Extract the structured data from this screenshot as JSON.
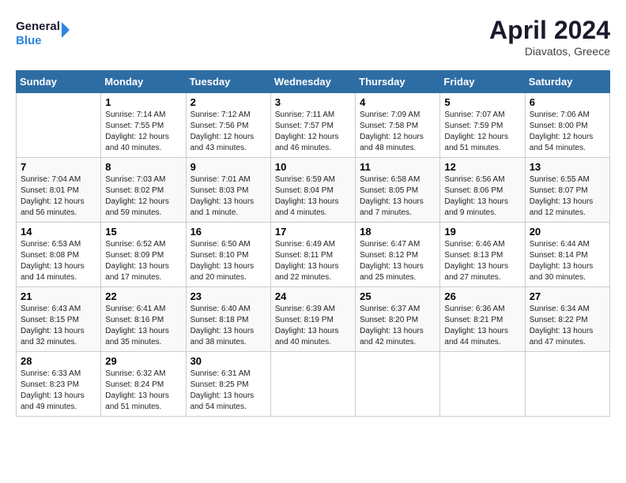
{
  "header": {
    "logo_line1": "General",
    "logo_line2": "Blue",
    "month_year": "April 2024",
    "location": "Diavatos, Greece"
  },
  "weekdays": [
    "Sunday",
    "Monday",
    "Tuesday",
    "Wednesday",
    "Thursday",
    "Friday",
    "Saturday"
  ],
  "weeks": [
    [
      {
        "day": "",
        "info": ""
      },
      {
        "day": "1",
        "info": "Sunrise: 7:14 AM\nSunset: 7:55 PM\nDaylight: 12 hours\nand 40 minutes."
      },
      {
        "day": "2",
        "info": "Sunrise: 7:12 AM\nSunset: 7:56 PM\nDaylight: 12 hours\nand 43 minutes."
      },
      {
        "day": "3",
        "info": "Sunrise: 7:11 AM\nSunset: 7:57 PM\nDaylight: 12 hours\nand 46 minutes."
      },
      {
        "day": "4",
        "info": "Sunrise: 7:09 AM\nSunset: 7:58 PM\nDaylight: 12 hours\nand 48 minutes."
      },
      {
        "day": "5",
        "info": "Sunrise: 7:07 AM\nSunset: 7:59 PM\nDaylight: 12 hours\nand 51 minutes."
      },
      {
        "day": "6",
        "info": "Sunrise: 7:06 AM\nSunset: 8:00 PM\nDaylight: 12 hours\nand 54 minutes."
      }
    ],
    [
      {
        "day": "7",
        "info": "Sunrise: 7:04 AM\nSunset: 8:01 PM\nDaylight: 12 hours\nand 56 minutes."
      },
      {
        "day": "8",
        "info": "Sunrise: 7:03 AM\nSunset: 8:02 PM\nDaylight: 12 hours\nand 59 minutes."
      },
      {
        "day": "9",
        "info": "Sunrise: 7:01 AM\nSunset: 8:03 PM\nDaylight: 13 hours\nand 1 minute."
      },
      {
        "day": "10",
        "info": "Sunrise: 6:59 AM\nSunset: 8:04 PM\nDaylight: 13 hours\nand 4 minutes."
      },
      {
        "day": "11",
        "info": "Sunrise: 6:58 AM\nSunset: 8:05 PM\nDaylight: 13 hours\nand 7 minutes."
      },
      {
        "day": "12",
        "info": "Sunrise: 6:56 AM\nSunset: 8:06 PM\nDaylight: 13 hours\nand 9 minutes."
      },
      {
        "day": "13",
        "info": "Sunrise: 6:55 AM\nSunset: 8:07 PM\nDaylight: 13 hours\nand 12 minutes."
      }
    ],
    [
      {
        "day": "14",
        "info": "Sunrise: 6:53 AM\nSunset: 8:08 PM\nDaylight: 13 hours\nand 14 minutes."
      },
      {
        "day": "15",
        "info": "Sunrise: 6:52 AM\nSunset: 8:09 PM\nDaylight: 13 hours\nand 17 minutes."
      },
      {
        "day": "16",
        "info": "Sunrise: 6:50 AM\nSunset: 8:10 PM\nDaylight: 13 hours\nand 20 minutes."
      },
      {
        "day": "17",
        "info": "Sunrise: 6:49 AM\nSunset: 8:11 PM\nDaylight: 13 hours\nand 22 minutes."
      },
      {
        "day": "18",
        "info": "Sunrise: 6:47 AM\nSunset: 8:12 PM\nDaylight: 13 hours\nand 25 minutes."
      },
      {
        "day": "19",
        "info": "Sunrise: 6:46 AM\nSunset: 8:13 PM\nDaylight: 13 hours\nand 27 minutes."
      },
      {
        "day": "20",
        "info": "Sunrise: 6:44 AM\nSunset: 8:14 PM\nDaylight: 13 hours\nand 30 minutes."
      }
    ],
    [
      {
        "day": "21",
        "info": "Sunrise: 6:43 AM\nSunset: 8:15 PM\nDaylight: 13 hours\nand 32 minutes."
      },
      {
        "day": "22",
        "info": "Sunrise: 6:41 AM\nSunset: 8:16 PM\nDaylight: 13 hours\nand 35 minutes."
      },
      {
        "day": "23",
        "info": "Sunrise: 6:40 AM\nSunset: 8:18 PM\nDaylight: 13 hours\nand 38 minutes."
      },
      {
        "day": "24",
        "info": "Sunrise: 6:39 AM\nSunset: 8:19 PM\nDaylight: 13 hours\nand 40 minutes."
      },
      {
        "day": "25",
        "info": "Sunrise: 6:37 AM\nSunset: 8:20 PM\nDaylight: 13 hours\nand 42 minutes."
      },
      {
        "day": "26",
        "info": "Sunrise: 6:36 AM\nSunset: 8:21 PM\nDaylight: 13 hours\nand 44 minutes."
      },
      {
        "day": "27",
        "info": "Sunrise: 6:34 AM\nSunset: 8:22 PM\nDaylight: 13 hours\nand 47 minutes."
      }
    ],
    [
      {
        "day": "28",
        "info": "Sunrise: 6:33 AM\nSunset: 8:23 PM\nDaylight: 13 hours\nand 49 minutes."
      },
      {
        "day": "29",
        "info": "Sunrise: 6:32 AM\nSunset: 8:24 PM\nDaylight: 13 hours\nand 51 minutes."
      },
      {
        "day": "30",
        "info": "Sunrise: 6:31 AM\nSunset: 8:25 PM\nDaylight: 13 hours\nand 54 minutes."
      },
      {
        "day": "",
        "info": ""
      },
      {
        "day": "",
        "info": ""
      },
      {
        "day": "",
        "info": ""
      },
      {
        "day": "",
        "info": ""
      }
    ]
  ]
}
